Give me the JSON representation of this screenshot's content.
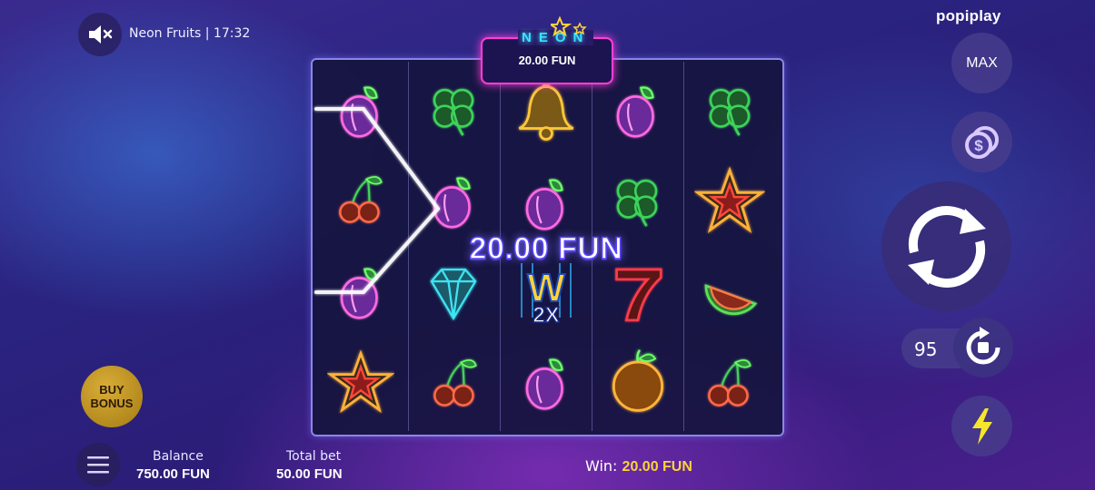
{
  "header": {
    "game_title": "Neon Fruits | 17:32",
    "sound_icon": "speaker-muted-icon"
  },
  "brand": {
    "name": "popiplay"
  },
  "logo": {
    "title": "NEON",
    "amount": "20.00 FUN"
  },
  "reels": {
    "columns": [
      [
        "plum",
        "cherry",
        "plum",
        "star"
      ],
      [
        "clover",
        "plum",
        "diamond",
        "cherry"
      ],
      [
        "bell",
        "plum",
        "wild-2x",
        "plum"
      ],
      [
        "plum",
        "clover",
        "seven",
        "orange"
      ],
      [
        "clover",
        "star",
        "watermelon",
        "cherry"
      ]
    ],
    "wild_label": "W",
    "wild_multiplier": "2X"
  },
  "win_overlay": {
    "amount": "20.00 FUN"
  },
  "controls": {
    "max_label": "MAX",
    "bet_icon": "coins-icon",
    "spin_icon": "spin-arrows-icon",
    "autoplay_count": "95",
    "autoplay_icon": "autoplay-icon",
    "turbo_icon": "lightning-icon",
    "buy_bonus_line1": "BUY",
    "buy_bonus_line2": "BONUS",
    "menu_icon": "hamburger-menu-icon"
  },
  "footer": {
    "balance_label": "Balance",
    "balance_value": "750.00 FUN",
    "total_bet_label": "Total bet",
    "total_bet_value": "50.00 FUN",
    "win_label": "Win:",
    "win_value": "20.00 FUN"
  },
  "colors": {
    "neon_pink": "#ff3ed8",
    "neon_cyan": "#39e3ff",
    "win_yellow": "#ffd23a",
    "buy_bonus_gold": "#c79a2a"
  }
}
